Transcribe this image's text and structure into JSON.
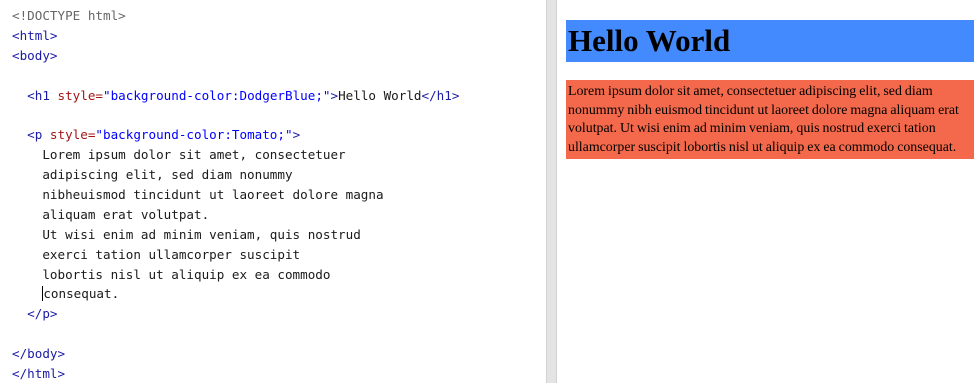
{
  "editor": {
    "doctype": "<!DOCTYPE html>",
    "html_open": "<html>",
    "body_open": "<body>",
    "h1_open_tag": "<h1 ",
    "h1_attr_name": "style=",
    "h1_attr_value": "\"background-color:DodgerBlue;\"",
    "h1_open_close": ">",
    "h1_text": "Hello World",
    "h1_close": "</h1>",
    "p_open_tag": "<p ",
    "p_attr_name": "style=",
    "p_attr_value": "\"background-color:Tomato;\"",
    "p_open_close": ">",
    "p_lines": [
      "Lorem ipsum dolor sit amet, consectetuer",
      "adipiscing elit, sed diam nonummy",
      "nibheuismod tincidunt ut laoreet dolore magna",
      "aliquam erat volutpat.",
      "Ut wisi enim ad minim veniam, quis nostrud",
      "exerci tation ullamcorper suscipit",
      "lobortis nisl ut aliquip ex ea commodo",
      "consequat."
    ],
    "p_close": "</p>",
    "body_close": "</body>",
    "html_close": "</html>"
  },
  "preview": {
    "h1_text": "Hello World",
    "h1_bg": "#448aff",
    "p_text": "Lorem ipsum dolor sit amet, consectetuer adipiscing elit, sed diam nonummy nibh euismod tincidunt ut laoreet dolore magna aliquam erat volutpat. Ut wisi enim ad minim veniam, quis nostrud exerci tation ullamcorper suscipit lobortis nisl ut aliquip ex ea commodo consequat.",
    "p_bg": "#f4694b"
  }
}
